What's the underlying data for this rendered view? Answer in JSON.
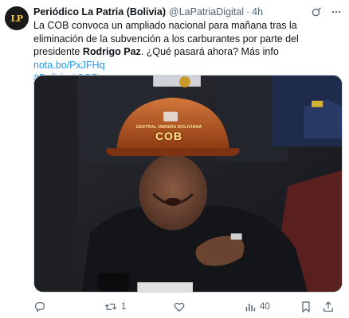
{
  "tweet": {
    "author_name": "Periódico La Patria (Bolivia)",
    "handle": "@LaPatriaDigital",
    "separator": "·",
    "time": "4h",
    "avatar_text": "LP",
    "text_part1": "La COB convoca un ampliado nacional para mañana tras la eliminación de la subvención a los carburantes por parte del presidente ",
    "text_bold": "Rodrigo Paz",
    "text_part2": ". ¿Qué pasará ahora? Más info ",
    "link": "nota.bo/PxJFHq",
    "hashtags": "#Bolivia #COB",
    "helmet_text": "COB",
    "helmet_small_text": "CENTRAL OBRERA BOLIVIANA"
  },
  "actions": {
    "reply_count": "",
    "retweet_count": "1",
    "like_count": "",
    "views_count": "40"
  },
  "icons": {
    "avatar": "newspaper-logo",
    "grok": "grok-icon",
    "more": "more-icon",
    "reply": "reply-icon",
    "retweet": "retweet-icon",
    "like": "heart-icon",
    "views": "views-icon",
    "bookmark": "bookmark-icon",
    "share": "share-icon"
  },
  "colors": {
    "link": "#1d9bf0",
    "secondary_text": "#536471",
    "helmet": "#b5541f"
  }
}
